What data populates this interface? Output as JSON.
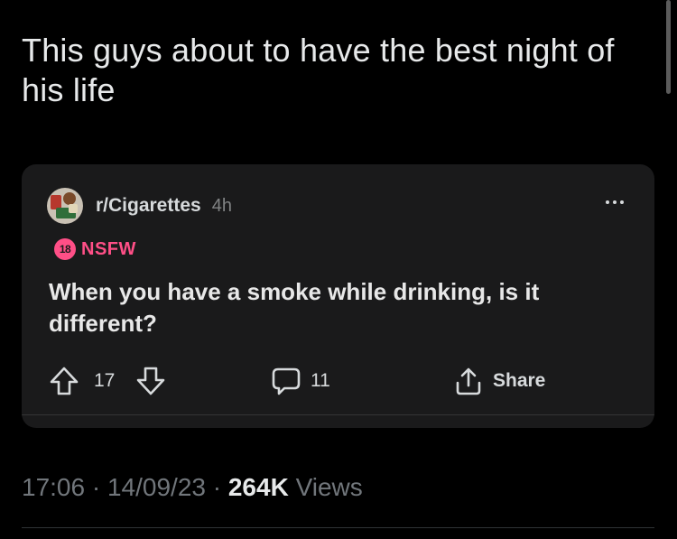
{
  "tweet": {
    "text": "This guys about to have the best night of his life",
    "time": "17:06",
    "date": "14/09/23",
    "separator": "·",
    "views_count": "264K",
    "views_label": "Views"
  },
  "embed": {
    "subreddit": "r/Cigarettes",
    "age": "4h",
    "nsfw_badge": "18",
    "nsfw_label": "NSFW",
    "title": "When you have a smoke while drinking, is it different?",
    "vote_count": "17",
    "comment_count": "11",
    "share_label": "Share"
  },
  "icons": {
    "upvote": "upvote-arrow-icon",
    "downvote": "downvote-arrow-icon",
    "comment": "comment-bubble-icon",
    "share": "share-icon",
    "more": "more-dots-icon"
  },
  "colors": {
    "background": "#000000",
    "card": "#1a1a1b",
    "nsfw": "#ff4f87",
    "muted": "#71767b"
  }
}
